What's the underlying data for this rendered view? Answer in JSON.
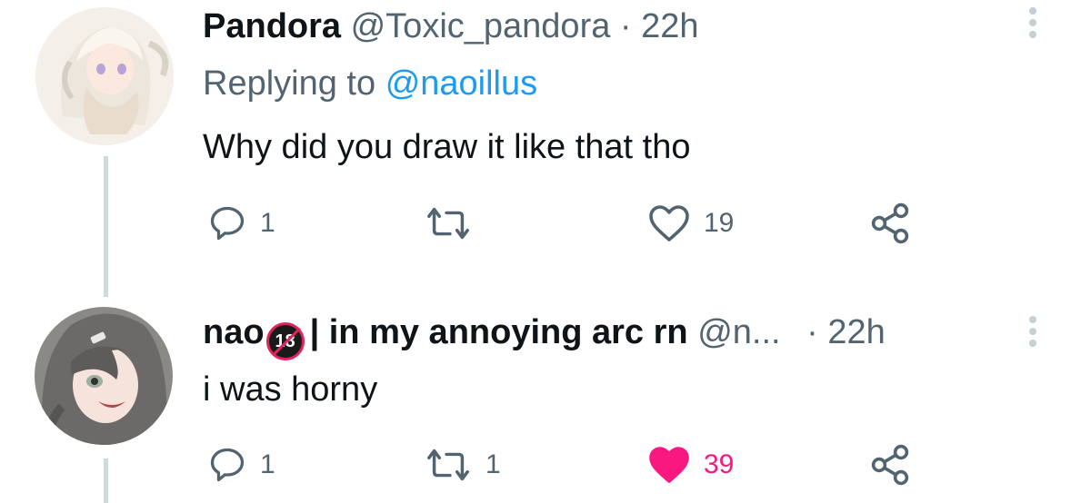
{
  "tweets": [
    {
      "display_name": "Pandora",
      "handle": "@Toxic_pandora",
      "separator": "·",
      "time": "22h",
      "replying_prefix": "Replying to",
      "replying_to": "@naoillus",
      "text": "Why did you draw it like that tho",
      "replies": "1",
      "retweets": "",
      "likes": "19",
      "liked": false,
      "avatar_icon": "anime-girl-white-hair-avatar"
    },
    {
      "display_name_prefix": "nao",
      "badge": "18",
      "display_name_suffix": "| in my annoying arc rn",
      "handle": "@n...",
      "separator": "·",
      "time": "22h",
      "text": "i was horny",
      "replies": "1",
      "retweets": "1",
      "likes": "39",
      "liked": true,
      "avatar_icon": "anime-girl-grey-hair-avatar"
    }
  ],
  "colors": {
    "link": "#1d9bf0",
    "muted": "#536471",
    "like_active": "#f91880",
    "thread_line": "#cfd9de"
  }
}
